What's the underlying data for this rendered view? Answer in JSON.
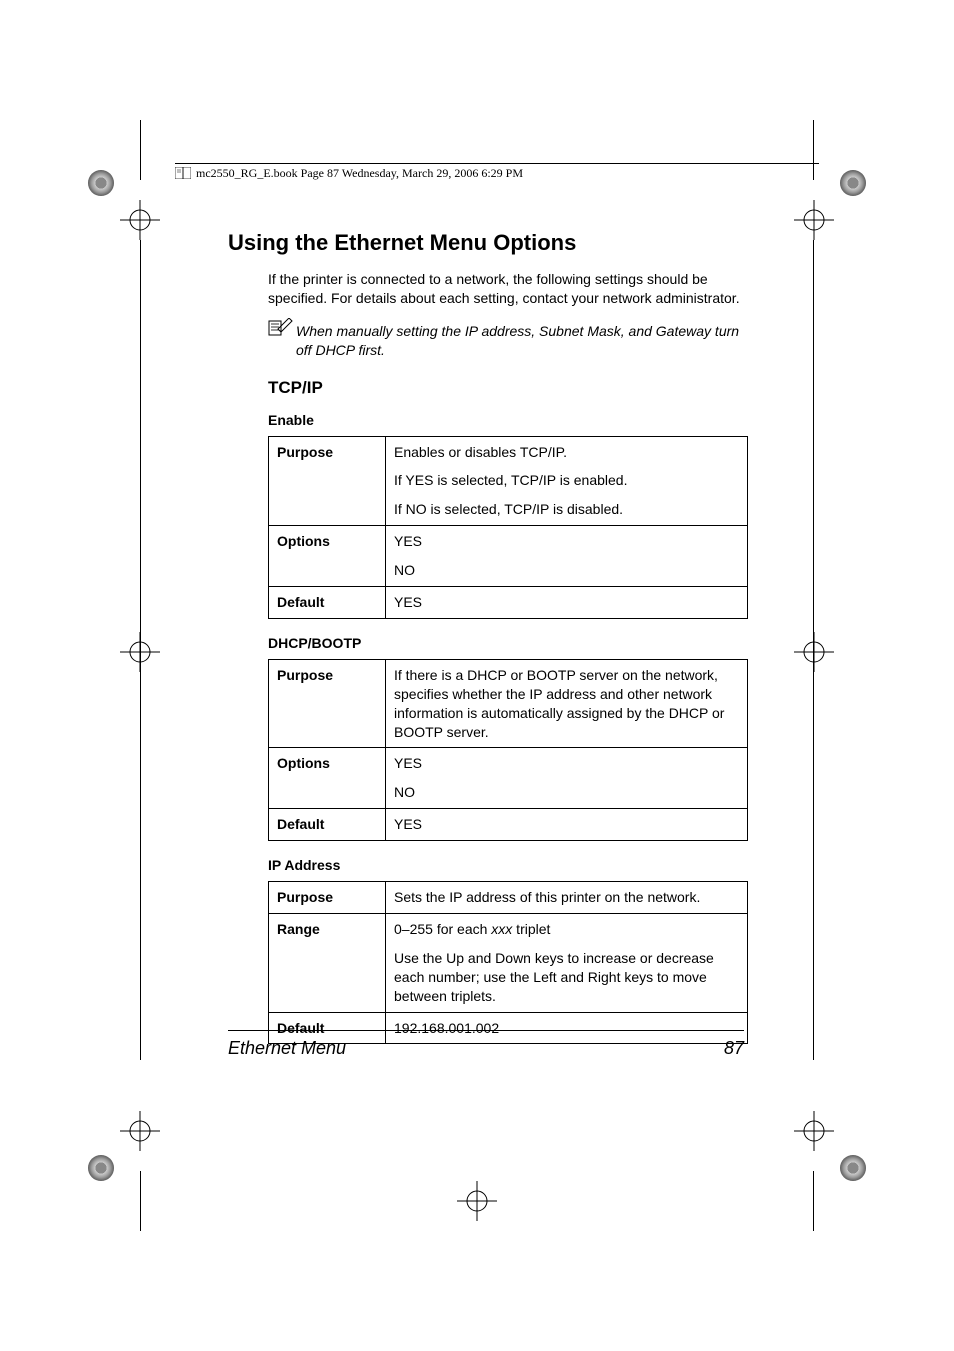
{
  "header": {
    "runhead": "mc2550_RG_E.book  Page 87  Wednesday, March 29, 2006  6:29 PM"
  },
  "title": "Using the Ethernet Menu Options",
  "intro": "If the printer is connected to a network, the following settings should be specified. For details about each setting, contact your network administrator.",
  "note": "When manually setting the IP address, Subnet Mask, and Gateway turn off DHCP first.",
  "section_heading": "TCP/IP",
  "tables": {
    "enable": {
      "heading": "Enable",
      "rows": {
        "purpose_label": "Purpose",
        "purpose1": "Enables or disables TCP/IP.",
        "purpose2": "If YES is selected, TCP/IP is enabled.",
        "purpose3": "If NO is selected, TCP/IP is disabled.",
        "options_label": "Options",
        "options1": "YES",
        "options2": "NO",
        "default_label": "Default",
        "default_val": "YES"
      }
    },
    "dhcp": {
      "heading": "DHCP/BOOTP",
      "rows": {
        "purpose_label": "Purpose",
        "purpose": "If there is a DHCP or BOOTP server on the network, specifies whether the IP address and other network information is automatically assigned by the DHCP or BOOTP server.",
        "options_label": "Options",
        "options1": "YES",
        "options2": "NO",
        "default_label": "Default",
        "default_val": "YES"
      }
    },
    "ip": {
      "heading": "IP Address",
      "rows": {
        "purpose_label": "Purpose",
        "purpose": "Sets the IP address of this printer on the network.",
        "range_label": "Range",
        "range_prefix": "0–255 for each ",
        "range_xxx": "xxx",
        "range_suffix": " triplet",
        "range2": "Use the Up and Down keys to increase or decrease each number; use the Left and Right keys to move between triplets.",
        "default_label": "Default",
        "default_val": "192.168.001.002"
      }
    }
  },
  "footer": {
    "section": "Ethernet Menu",
    "page": "87"
  }
}
